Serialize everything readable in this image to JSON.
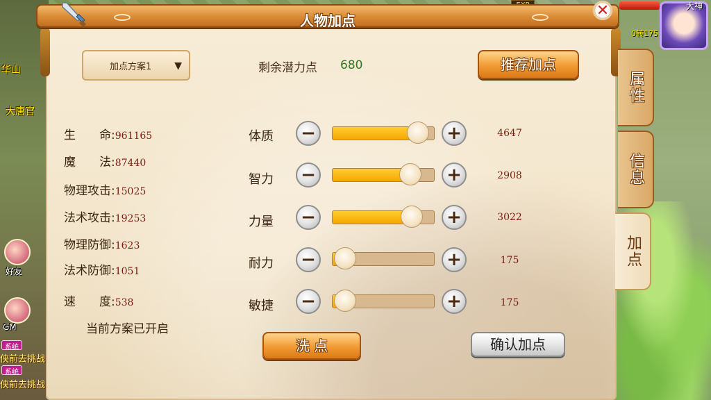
{
  "dialog": {
    "title": "人物加点",
    "scheme_selected": "加点方案1",
    "remaining_label": "剩余潜力点",
    "remaining_value": "680",
    "recommend_button": "推荐加点",
    "reset_button": "洗 点",
    "confirm_button": "确认加点",
    "status_text": "当前方案已开启"
  },
  "stats": [
    {
      "label": "生　　命",
      "value": "961165"
    },
    {
      "label": "魔　　法",
      "value": "87440"
    },
    {
      "label": "物理攻击",
      "value": "15025"
    },
    {
      "label": "法术攻击",
      "value": "19253"
    },
    {
      "label": "物理防御",
      "value": "1623"
    },
    {
      "label": "法术防御",
      "value": "1051"
    },
    {
      "label": "速　　度",
      "value": "538"
    }
  ],
  "attributes": [
    {
      "label": "体质",
      "value": "4647",
      "fill": 0.84
    },
    {
      "label": "智力",
      "value": "2908",
      "fill": 0.77
    },
    {
      "label": "力量",
      "value": "3022",
      "fill": 0.78
    },
    {
      "label": "耐力",
      "value": "175",
      "fill": 0.12
    },
    {
      "label": "敏捷",
      "value": "175",
      "fill": 0.12
    }
  ],
  "side_tabs": [
    {
      "label": "属性",
      "active": false
    },
    {
      "label": "信息",
      "active": false
    },
    {
      "label": "加点",
      "active": true
    }
  ],
  "hud": {
    "player_name": "大神",
    "level_text": "0转175",
    "exp_tag": "EXP"
  },
  "world": {
    "location_1": "华山",
    "location_2": "大唐官",
    "friends_label": "好友",
    "gm_label": "GM",
    "system_badge": "系统",
    "chat_line": "侠前去挑战"
  },
  "icons": {
    "close": "close-icon",
    "sword": "sword-icon",
    "dropdown_arrow": "triangle-down-icon",
    "minus": "minus-icon",
    "plus": "plus-icon"
  },
  "colors": {
    "title_bar": "#d98a35",
    "panel_bg": "#f3e5cb",
    "slider_fill": "#f6a700",
    "value_text": "#7a1a10",
    "remain_value": "#2d7a1e"
  }
}
